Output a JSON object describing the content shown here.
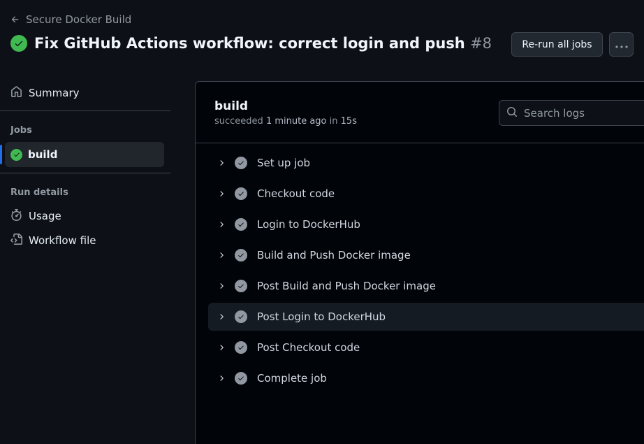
{
  "header": {
    "back_label": "Secure Docker Build",
    "title": "Fix GitHub Actions workflow: correct login and push",
    "run_number": "#8",
    "rerun_label": "Re-run all jobs"
  },
  "sidebar": {
    "summary_label": "Summary",
    "jobs_heading": "Jobs",
    "job_label": "build",
    "run_details_heading": "Run details",
    "usage_label": "Usage",
    "workflow_file_label": "Workflow file"
  },
  "job": {
    "name": "build",
    "status_word": "succeeded",
    "time_ago": "1 minute ago",
    "in_word": "in",
    "duration": "15s",
    "search_placeholder": "Search logs"
  },
  "steps": [
    "Set up job",
    "Checkout code",
    "Login to DockerHub",
    "Build and Push Docker image",
    "Post Build and Push Docker image",
    "Post Login to DockerHub",
    "Post Checkout code",
    "Complete job"
  ],
  "colors": {
    "success": "#3fb950",
    "accent": "#1f6feb",
    "background": "#0d1117",
    "panel": "#010409"
  }
}
